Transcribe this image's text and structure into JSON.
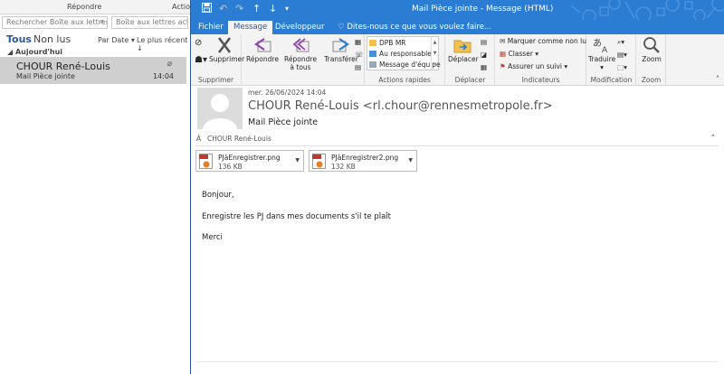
{
  "main": {
    "header_left": "Répondre",
    "header_right": "Actio",
    "search_mailbox": "Rechercher Boîte aux lettres ...",
    "search_current": "Boîte aux lettres actuelle",
    "filter_all": "Tous",
    "filter_unread": "Non lus",
    "sort_by": "Par Date",
    "sort_order": "Le plus récent",
    "group_today": "Aujourd'hui",
    "item": {
      "sender": "CHOUR René-Louis",
      "subject": "Mail Pièce jointe",
      "time": "14:04"
    }
  },
  "window": {
    "title": "Mail Pièce jointe  -  Message (HTML)",
    "tabs": {
      "file": "Fichier",
      "message": "Message",
      "developer": "Développeur",
      "tell_me": "Dites-nous ce que vous voulez faire..."
    }
  },
  "ribbon": {
    "delete": "Supprimer",
    "reply": "Répondre",
    "reply_all_1": "Répondre",
    "reply_all_2": "à tous",
    "forward": "Transférer",
    "group_delete": "Supprimer",
    "group_respond": "Répondre",
    "quick_steps": [
      "DPB MR",
      "Au responsable",
      "Message d'équipe"
    ],
    "group_quick": "Actions rapides",
    "move": "Déplacer",
    "group_move": "Déplacer",
    "mark_unread": "Marquer comme non lu",
    "categorize": "Classer",
    "follow_up": "Assurer un suivi",
    "group_tags": "Indicateurs",
    "translate": "Traduire",
    "group_edit": "Modification",
    "zoom": "Zoom",
    "group_zoom": "Zoom"
  },
  "message": {
    "date": "mer. 26/06/2024 14:04",
    "from": "CHOUR René-Louis <rl.chour@rennesmetropole.fr>",
    "subject": "Mail Pièce jointe",
    "to_label": "À",
    "to": "CHOUR René-Louis",
    "attachments": [
      {
        "name": "PJàEnregistrer.png",
        "size": "136 KB"
      },
      {
        "name": "PJàEnregistrer2.png",
        "size": "132 KB"
      }
    ],
    "body": [
      "Bonjour,",
      "Enregistre les PJ dans mes documents s'il te plaît",
      "Merci"
    ]
  },
  "colors": {
    "titlebar": "#2b7cd3",
    "ribbon": "#f3f3f3",
    "selected_item": "#cfcfcf",
    "accent": "#2b579a"
  }
}
